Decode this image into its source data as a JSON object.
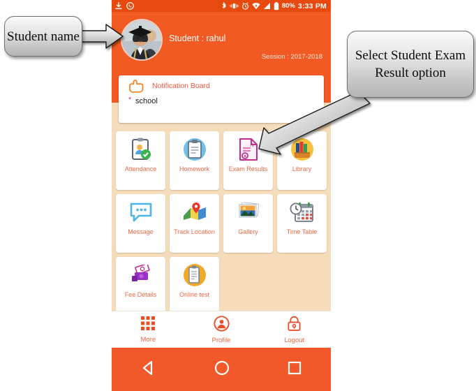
{
  "statusbar": {
    "left_icons": [
      "download-icon",
      "whatsapp-icon"
    ],
    "right_icons": [
      "bluetooth-icon",
      "vibrate-icon",
      "alarm-icon",
      "wifi-icon",
      "signal-icon",
      "battery-icon"
    ],
    "battery_percent": "80%",
    "time": "3:33 PM"
  },
  "header": {
    "student_label": "Student : rahul",
    "session_label": "Session : 2017-2018",
    "avatar_name": "student-avatar",
    "bg_color": "#f15a22"
  },
  "notification_board": {
    "title": "Notification Board",
    "items": [
      "school"
    ],
    "bullet": "*"
  },
  "grid": {
    "rows": [
      [
        {
          "label": "Attendance",
          "icon": "attendance-icon"
        },
        {
          "label": "Homework",
          "icon": "homework-icon"
        },
        {
          "label": "Exam Results",
          "icon": "exam-results-icon"
        },
        {
          "label": "Library",
          "icon": "library-icon"
        }
      ],
      [
        {
          "label": "Message",
          "icon": "message-icon"
        },
        {
          "label": "Track Location",
          "icon": "track-location-icon"
        },
        {
          "label": "Gallery",
          "icon": "gallery-icon"
        },
        {
          "label": "Time Table",
          "icon": "time-table-icon"
        }
      ],
      [
        {
          "label": "Fee Details",
          "icon": "fee-details-icon"
        },
        {
          "label": "Online test",
          "icon": "online-test-icon"
        }
      ]
    ]
  },
  "bottom_nav": [
    {
      "label": "More",
      "icon": "grid-more-icon"
    },
    {
      "label": "Profile",
      "icon": "profile-person-icon"
    },
    {
      "label": "Logout",
      "icon": "lock-logout-icon"
    }
  ],
  "system_nav": [
    {
      "name": "back-button",
      "icon": "triangle-back-icon"
    },
    {
      "name": "home-button",
      "icon": "circle-home-icon"
    },
    {
      "name": "recents-button",
      "icon": "square-recents-icon"
    }
  ],
  "annotations": {
    "left_callout": "Student name",
    "right_callout": "Select Student Exam Result option"
  },
  "colors": {
    "accent_orange": "#f15a22",
    "statusbar_orange": "#e8490f",
    "page_beige": "#f5dcba",
    "tile_label": "#ef6a45",
    "callout_border": "#6f6f6f"
  }
}
